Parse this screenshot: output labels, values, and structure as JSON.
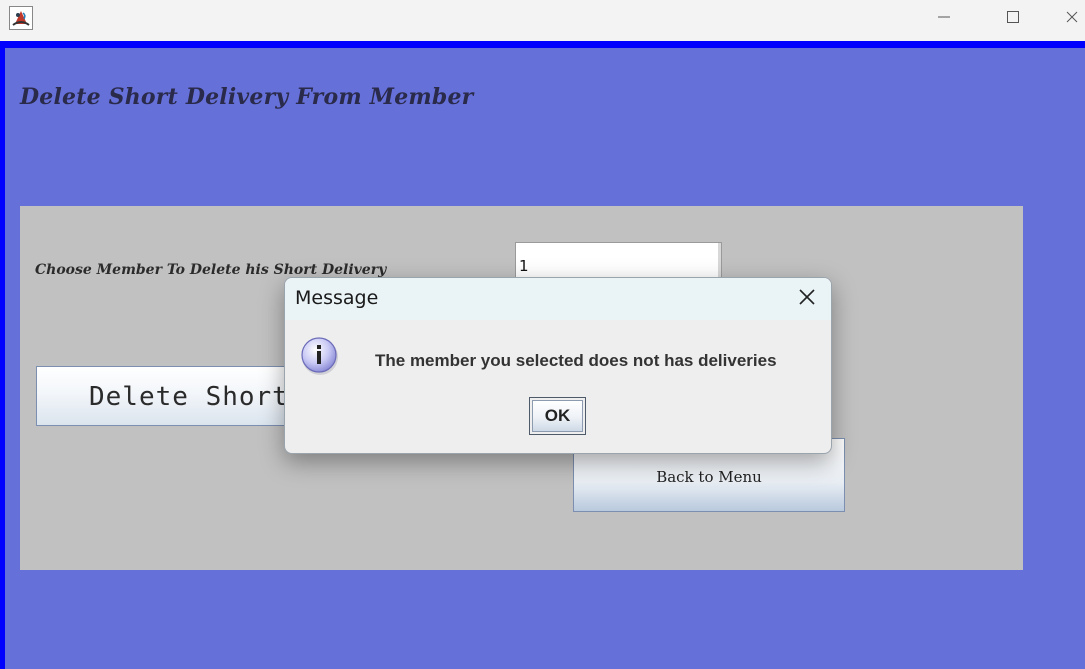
{
  "window": {
    "icon": "java-app-icon",
    "controls": [
      {
        "name": "minimize",
        "icon": "minimize-icon"
      },
      {
        "name": "maximize",
        "icon": "maximize-icon"
      },
      {
        "name": "close",
        "icon": "close-icon"
      }
    ]
  },
  "page": {
    "title": "Delete Short Delivery From Member",
    "choose_label": "Choose Member To Delete his Short Delivery",
    "member_value": "1",
    "delete_button": "Delete Short",
    "back_button": "Back to Menu"
  },
  "dialog": {
    "title": "Message",
    "message": "The member you selected does not has deliveries",
    "ok_button": "OK",
    "icon": "info-icon"
  },
  "colors": {
    "frame_border": "#0000ff",
    "content_background": "#6670d9",
    "panel_background": "#c1c1c1",
    "dialog_background": "#eeeeee",
    "dialog_titlebar": "#eaf3f5"
  }
}
